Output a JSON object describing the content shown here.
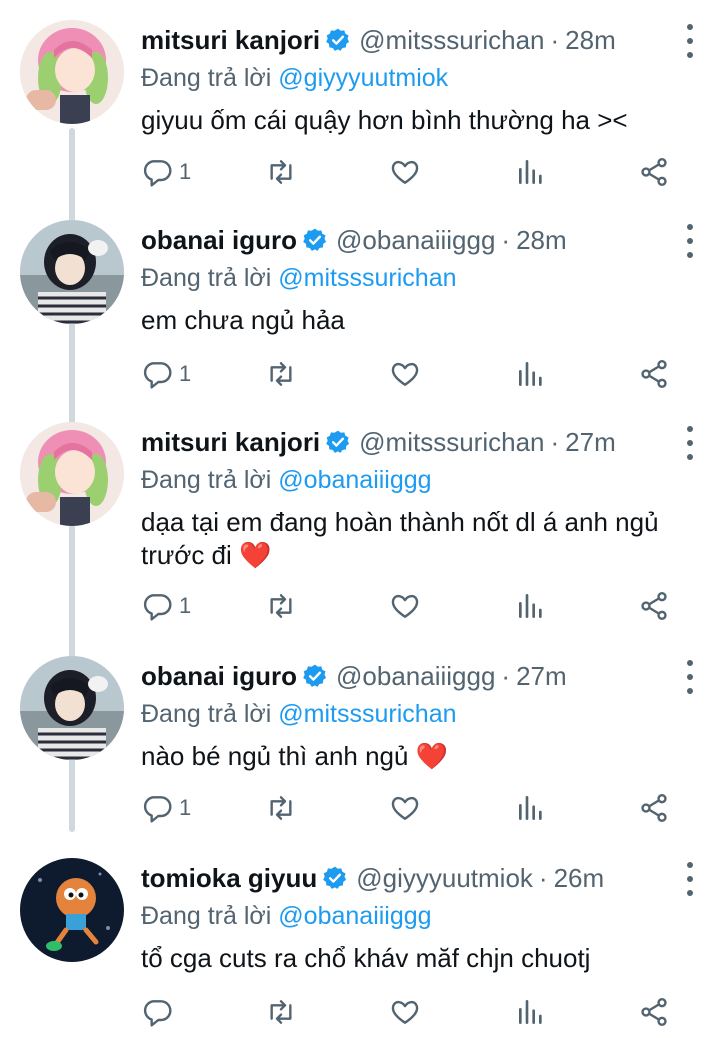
{
  "tweets": [
    {
      "name": "mitsuri kanjori",
      "handle": "@mitsssurichan",
      "time": "28m",
      "reply_prefix": "Đang trả lời",
      "reply_to": "@giyyyuutmiok",
      "text": "giyuu ốm cái quậy hơn bình thường ha ><",
      "reply_count": "1",
      "avatar": "mitsuri-avatar"
    },
    {
      "name": "obanai iguro",
      "handle": "@obanaiiiggg",
      "time": "28m",
      "reply_prefix": "Đang trả lời",
      "reply_to": "@mitsssurichan",
      "text": "em chưa ngủ hảa",
      "reply_count": "1",
      "avatar": "obanai-avatar"
    },
    {
      "name": "mitsuri kanjori",
      "handle": "@mitsssurichan",
      "time": "27m",
      "reply_prefix": "Đang trả lời",
      "reply_to": "@obanaiiiggg",
      "text": "dạa tại em đang hoàn thành nốt dl á anh ngủ trước đi ❤️",
      "reply_count": "1",
      "avatar": "mitsuri-avatar"
    },
    {
      "name": "obanai iguro",
      "handle": "@obanaiiiggg",
      "time": "27m",
      "reply_prefix": "Đang trả lời",
      "reply_to": "@mitsssurichan",
      "text": "nào bé ngủ thì anh ngủ ❤️",
      "reply_count": "1",
      "avatar": "obanai-avatar"
    },
    {
      "name": "tomioka giyuu",
      "handle": "@giyyyuutmiok",
      "time": "26m",
      "reply_prefix": "Đang trả lời",
      "reply_to": "@obanaiiiggg",
      "text": "tổ cga cuts ra chổ kháv măf chjn chuotj",
      "reply_count": "",
      "avatar": "giyuu-avatar"
    }
  ],
  "colors": {
    "accent": "#1d9bf0",
    "muted": "#536471",
    "thread_line": "#cfd9de"
  },
  "icons": [
    "reply-icon",
    "retweet-icon",
    "like-icon",
    "views-icon",
    "share-icon",
    "verified-badge-icon",
    "more-icon"
  ]
}
